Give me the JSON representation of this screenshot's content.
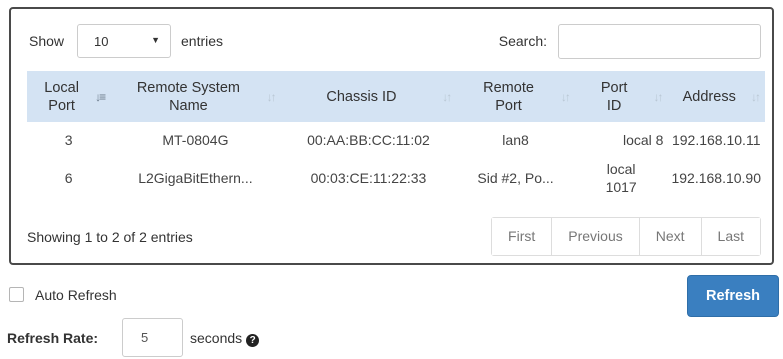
{
  "controls": {
    "show_label": "Show",
    "entries_value": "10",
    "entries_label": "entries",
    "search_label": "Search:",
    "search_value": "",
    "search_placeholder": ""
  },
  "table": {
    "headers": [
      {
        "label": "Local Port",
        "line1": "Local",
        "line2": "Port",
        "sorted": "ascending"
      },
      {
        "label": "Remote System Name",
        "line1": "Remote System",
        "line2": "Name",
        "sorted": "none"
      },
      {
        "label": "Chassis ID",
        "line1": "Chassis ID",
        "line2": "",
        "sorted": "none"
      },
      {
        "label": "Remote Port",
        "line1": "Remote",
        "line2": "Port",
        "sorted": "none"
      },
      {
        "label": "Port ID",
        "line1": "Port",
        "line2": "ID",
        "sorted": "none"
      },
      {
        "label": "Address",
        "line1": "Address",
        "line2": "",
        "sorted": "none"
      }
    ],
    "rows": [
      {
        "local_port": "3",
        "remote_system_name": "MT-0804G",
        "chassis_id": "00:AA:BB:CC:11:02",
        "remote_port": "lan8",
        "port_id_line1": "local 8",
        "port_id_line2": "",
        "address": "192.168.10.11"
      },
      {
        "local_port": "6",
        "remote_system_name": "L2GigaBitEthern...",
        "chassis_id": "00:03:CE:11:22:33",
        "remote_port": "Sid #2, Po...",
        "port_id_line1": "local",
        "port_id_line2": "1017",
        "address": "192.168.10.90"
      }
    ]
  },
  "footer": {
    "info": "Showing 1 to 2 of 2 entries",
    "pagination": [
      "First",
      "Previous",
      "Next",
      "Last"
    ]
  },
  "auto_refresh": {
    "label": "Auto Refresh",
    "checked": false
  },
  "refresh_button": "Refresh",
  "refresh_rate": {
    "label": "Refresh Rate:",
    "value": "5",
    "unit": "seconds",
    "help_icon": "question-circle-icon"
  },
  "colors": {
    "header_bg": "#d4e3f3",
    "primary_button": "#3a7fc0",
    "panel_border": "#4a4a4a"
  }
}
